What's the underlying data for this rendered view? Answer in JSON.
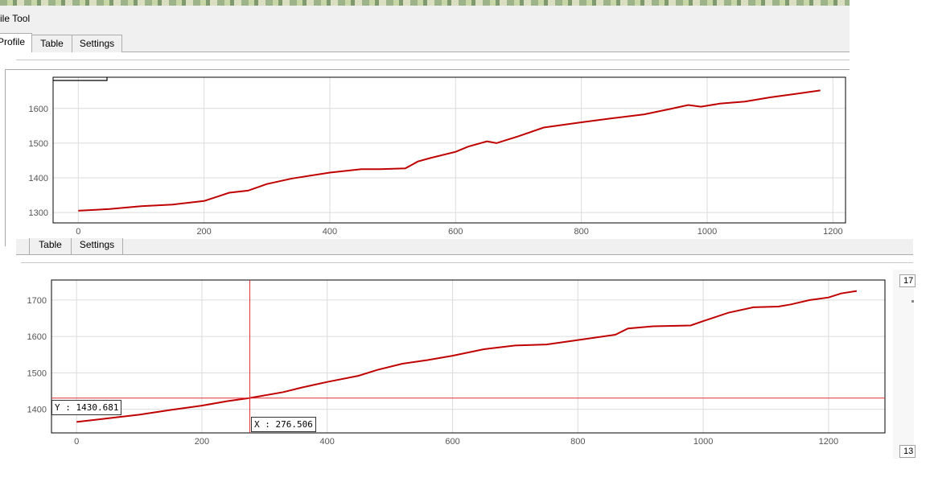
{
  "window": {
    "title": "ile Tool"
  },
  "tabs_top": [
    {
      "label": "Profile",
      "active": true
    },
    {
      "label": "Table",
      "active": false
    },
    {
      "label": "Settings",
      "active": false
    }
  ],
  "tabs_middle": [
    {
      "label": "Table"
    },
    {
      "label": "Settings"
    }
  ],
  "side_values": {
    "top": "17",
    "bottom": "13"
  },
  "cursor_readout": {
    "y_text": "Y : 1430.681",
    "x_text": "X : 276.506",
    "x": 276.506,
    "y": 1430.681
  },
  "colors": {
    "profile_line": "#c00000",
    "crosshair": "#e03030",
    "grid": "#dcdcdc"
  },
  "chart_data": [
    {
      "type": "line",
      "title": "",
      "xlabel": "",
      "ylabel": "",
      "xlim": [
        -40,
        1220
      ],
      "ylim": [
        1270,
        1690
      ],
      "xticks": [
        0,
        200,
        400,
        600,
        800,
        1000,
        1200
      ],
      "yticks": [
        1300,
        1400,
        1500,
        1600
      ],
      "grid": true,
      "series": [
        {
          "x": [
            0,
            50,
            100,
            150,
            200,
            220,
            240,
            270,
            300,
            340,
            400,
            450,
            480,
            520,
            540,
            560,
            600,
            620,
            650,
            665,
            700,
            740,
            800,
            850,
            900,
            940,
            970,
            990,
            1020,
            1060,
            1100,
            1140,
            1180
          ],
          "y": [
            1305,
            1310,
            1318,
            1323,
            1333,
            1345,
            1357,
            1363,
            1382,
            1398,
            1415,
            1425,
            1425,
            1427,
            1447,
            1457,
            1475,
            1490,
            1505,
            1500,
            1520,
            1545,
            1560,
            1572,
            1583,
            1598,
            1610,
            1605,
            1614,
            1620,
            1632,
            1642,
            1652
          ]
        }
      ]
    },
    {
      "type": "line",
      "title": "",
      "xlabel": "",
      "ylabel": "",
      "xlim": [
        -40,
        1290
      ],
      "ylim": [
        1335,
        1755
      ],
      "xticks": [
        0,
        200,
        400,
        600,
        800,
        1000,
        1200
      ],
      "yticks": [
        1400,
        1500,
        1600,
        1700
      ],
      "grid": true,
      "crosshair": {
        "x": 276.506,
        "y": 1430.681
      },
      "series": [
        {
          "x": [
            0,
            50,
            100,
            150,
            200,
            240,
            276.5,
            330,
            360,
            400,
            450,
            480,
            520,
            560,
            600,
            650,
            700,
            750,
            800,
            860,
            880,
            920,
            980,
            1000,
            1040,
            1080,
            1120,
            1140,
            1170,
            1200,
            1220,
            1245
          ],
          "y": [
            1365,
            1375,
            1385,
            1398,
            1410,
            1422,
            1431,
            1447,
            1460,
            1475,
            1492,
            1508,
            1525,
            1535,
            1547,
            1565,
            1575,
            1578,
            1590,
            1605,
            1622,
            1628,
            1630,
            1642,
            1665,
            1680,
            1682,
            1688,
            1700,
            1707,
            1718,
            1725
          ]
        }
      ]
    }
  ]
}
